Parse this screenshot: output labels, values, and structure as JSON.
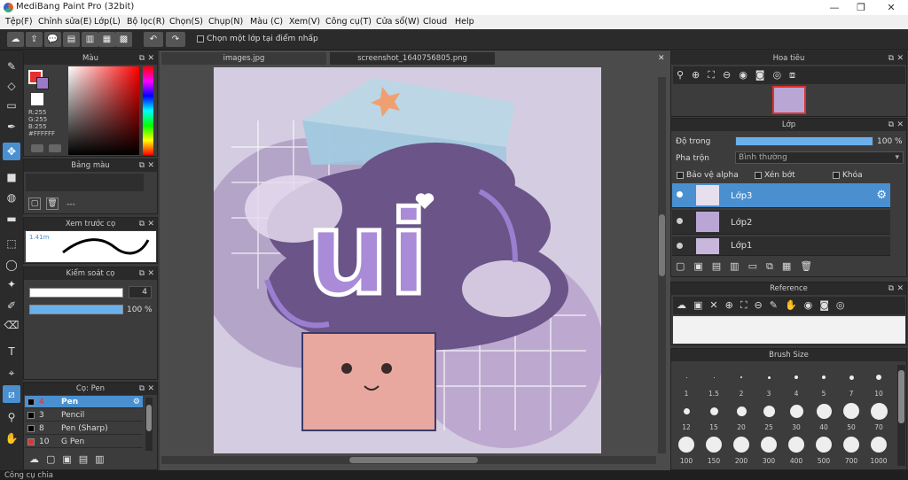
{
  "window": {
    "title": "MediBang Paint Pro (32bit)",
    "min": "—",
    "max": "❐",
    "close": "✕"
  },
  "menu": [
    "Tệp(F)",
    "Chỉnh sửa(E)",
    "Lớp(L)",
    "Bộ lọc(R)",
    "Chọn(S)",
    "Chụp(N)",
    "Màu (C)",
    "Xem(V)",
    "Công cụ(T)",
    "Cửa sổ(W)",
    "Cloud",
    "Help"
  ],
  "toolbar": {
    "checkbox_label": "Chọn một lớp tại điểm nhấp"
  },
  "color_panel": {
    "title": "Màu",
    "r": "R:255",
    "g": "G:255",
    "b": "B:255",
    "hex": "#FFFFFF"
  },
  "palette_panel": {
    "title": "Bảng màu",
    "value": "---"
  },
  "preview_panel": {
    "title": "Xem trước cọ",
    "size": "1.41m"
  },
  "brush_control": {
    "title": "Kiểm soát cọ",
    "size": "4",
    "opacity": "100 %",
    "size_fill": 0.98,
    "opacity_fill": 1.0
  },
  "brush_list": {
    "title": "Cọ: Pen",
    "items": [
      {
        "num": "4",
        "name": "Pen",
        "color": "#000000"
      },
      {
        "num": "3",
        "name": "Pencil",
        "color": "#000000"
      },
      {
        "num": "8",
        "name": "Pen (Sharp)",
        "color": "#000000"
      },
      {
        "num": "10",
        "name": "G Pen",
        "color": "#e53030"
      }
    ]
  },
  "tabs": [
    "images.jpg",
    "screenshot_1640756805.png"
  ],
  "navigator": {
    "title": "Hoa tiêu"
  },
  "layers_panel": {
    "title": "Lớp",
    "opacity_label": "Độ trong",
    "opacity_value": "100 %",
    "blend_label": "Pha trộn",
    "blend_value": "Bình thường",
    "protect_alpha": "Bảo vệ alpha",
    "clipping": "Xén bớt",
    "lock": "Khóa",
    "layers": [
      "Lớp3",
      "Lớp2",
      "Lớp1"
    ]
  },
  "reference_panel": {
    "title": "Reference"
  },
  "brush_size_panel": {
    "title": "Brush Size",
    "sizes": [
      "1",
      "1.5",
      "2",
      "3",
      "4",
      "5",
      "7",
      "10",
      "12",
      "15",
      "20",
      "25",
      "30",
      "40",
      "50",
      "70",
      "100",
      "150",
      "200",
      "300",
      "400",
      "500",
      "700",
      "1000"
    ]
  },
  "artwork": {
    "letters": "ui"
  },
  "status": "Công cụ chia"
}
